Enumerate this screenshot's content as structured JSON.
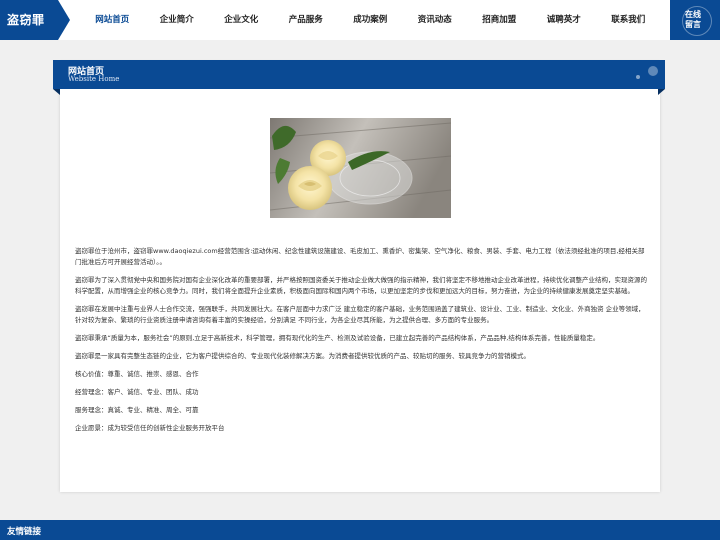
{
  "logo": {
    "text": "盗窃罪"
  },
  "nav": {
    "items": [
      {
        "label": "网站首页",
        "active": true
      },
      {
        "label": "企业简介",
        "active": false
      },
      {
        "label": "企业文化",
        "active": false
      },
      {
        "label": "产品服务",
        "active": false
      },
      {
        "label": "成功案例",
        "active": false
      },
      {
        "label": "资讯动态",
        "active": false
      },
      {
        "label": "招商加盟",
        "active": false
      },
      {
        "label": "诚聘英才",
        "active": false
      },
      {
        "label": "联系我们",
        "active": false
      }
    ]
  },
  "online": {
    "label": "在线留言"
  },
  "section": {
    "title": "网站首页",
    "subtitle": "Website Home"
  },
  "content": {
    "paragraphs": [
      "盗窃罪位于沧州市，盗窃罪www.daoqiezui.com经营范围含:运动休闲、纪念性建筑设施建设、毛皮加工、熏香炉、密集架、空气净化、粮食、男装、手套、电力工程（依法须经批准的项目,经相关部门批准后方可开展经营活动）。。",
      "盗窃罪为了深入贯彻党中央和国务院对国有企业深化改革的重要部署，并严格按照国资委关于推动企业做大做强的指示精神，我们将坚定不移地推动企业改革进程，持续优化调整产业结构，实现资源的科学配置，从而增强企业的核心竞争力。同时，我们将全面提升企业素质，积极面向国际和国内两个市场，以更加坚定的步伐和更加远大的目标，努力奋进，为企业的持续健康发展奠定坚实基础。",
      "盗窃罪在发展中注重与业界人士合作交流，强强联手，共同发展壮大。在客户层面中力求广泛 建立稳定的客户基础，业务范围涵盖了建筑业、设计业、工业、制造业、文化业、外商独资 企业等领域，针对较为复杂、繁琐的行业资质注册申请咨询有着丰富的实操经验，分别满足 不同行业，为各企业尽其所能，为之提供合理、多方面的专业服务。",
      "盗窃罪秉承“质量为本，服务社会”的原则,立足于高新技术，科学管理，拥有现代化的生产、检测及试验设备，已建立起完善的产品结构体系，产品品种,结构体系完善，性能质量稳定。",
      "盗窃罪是一家具有完整生态链的企业，它为客户提供综合的、专业现代化装修解决方案。为消费者提供较优质的产品、较贴切的服务、较具竞争力的营销模式。",
      "核心价值：尊重、诚信、推崇、感恩、合作",
      "经营理念：客户、诚信、专业、团队、成功",
      "服务理念：真诚、专业、精准、周全、可靠",
      "企业愿景：成为较受信任的创新性企业服务开放平台"
    ]
  },
  "footer": {
    "label": "友情链接"
  },
  "colors": {
    "brand": "#0a4a94",
    "text": "#333333",
    "background": "#f0f0f0"
  }
}
